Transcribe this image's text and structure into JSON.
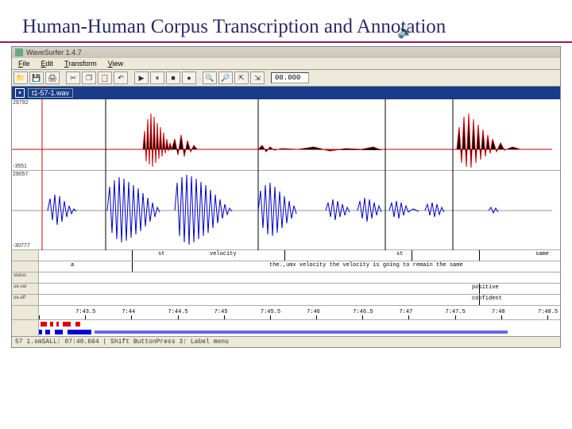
{
  "slide": {
    "title": "Human-Human Corpus Transcription and Annotation"
  },
  "app": {
    "title": "WaveSurfer 1.4.7",
    "menus": {
      "file": "File",
      "edit": "Edit",
      "transform": "Transform",
      "view": "View"
    },
    "toolbar_readout": "00.000",
    "filename": "t1-57-1.wav",
    "y_top_upper": "29792",
    "y_top_lower": "-3551",
    "y_bot_upper": "29057",
    "y_bot_lower": "-30777",
    "speech_tier_left": "st",
    "speech_tier_seg1": "velocity",
    "speech_tier_seg3": "st",
    "speech_tier_seg4": "same",
    "transcript_a": "a",
    "transcript_text": "the.,umx velocity the velocity is going to remain the same",
    "tier_status_label": "status",
    "tier_val_label": "ue.val",
    "tier_aff_label": "ue.aff",
    "val_text": "positive",
    "aff_text": "confident",
    "ticks": [
      "",
      "7:43.5",
      "7:44",
      "7:44.5",
      "7:45",
      "7:45.5",
      "7:46",
      "7:46.5",
      "7:47",
      "7:47.5",
      "7:48",
      "7:48.5"
    ],
    "status": "57 1.smSALL: 07:40.664 | Shift ButtonPress 3: Label menu"
  }
}
